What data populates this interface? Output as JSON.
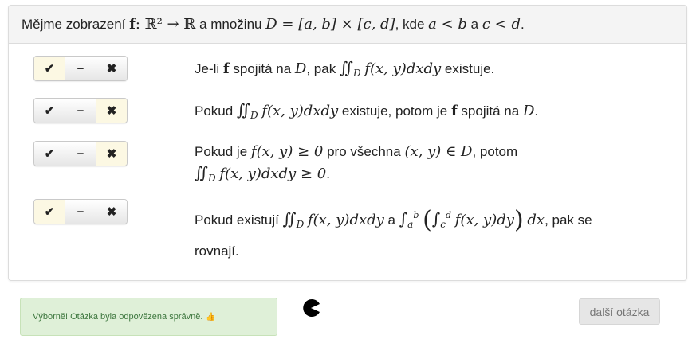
{
  "question": {
    "prefix": "Mějme zobrazení",
    "f": "f",
    "map": ": ℝ² → ℝ",
    "mid": "a množinu",
    "set": "D = [a, b] × [c, d]",
    "kde": ", kde",
    "cond1": "a < b",
    "and": "a",
    "cond2": "c < d",
    "end": "."
  },
  "buttons": {
    "yes": "✔",
    "neutral": "−",
    "no": "✖"
  },
  "statements": [
    {
      "selected": "yes",
      "t1": "Je-li",
      "f": "f",
      "t2": "spojitá na",
      "D": "D",
      "t3": ", pak",
      "integral": "∬",
      "sub": "D",
      "expr": "f(x, y)dxdy",
      "t4": "existuje."
    },
    {
      "selected": "no",
      "t1": "Pokud",
      "integral": "∬",
      "sub": "D",
      "expr": "f(x, y)dxdy",
      "t2": "existuje, potom je",
      "f": "f",
      "t3": "spojitá na",
      "D": "D",
      "end": "."
    },
    {
      "selected": "no",
      "t1": "Pokud je",
      "expr1": "f(x, y) ≥ 0",
      "t2": "pro všechna",
      "expr2": "(x, y) ∈ D",
      "t3": ", potom",
      "integral": "∬",
      "sub": "D",
      "expr3": "f(x, y)dxdy ≥ 0",
      "end": "."
    },
    {
      "selected": "yes",
      "t1": "Pokud existují",
      "integral": "∬",
      "sub": "D",
      "expr": "f(x, y)dxdy",
      "t2": "a",
      "int1": "∫",
      "lo1": "a",
      "hi1": "b",
      "lparen": "(",
      "int2": "∫",
      "lo2": "c",
      "hi2": "d",
      "inner": "f(x, y)dy",
      "rparen": ")",
      "dx": "dx",
      "t3": ", pak se",
      "t4": "rovnají."
    }
  ],
  "feedback": {
    "text": "Výborně! Otázka byla odpovězena správně.",
    "icon": "thumbs-up-icon",
    "icon_glyph": "👍"
  },
  "next_button": "další otázka"
}
